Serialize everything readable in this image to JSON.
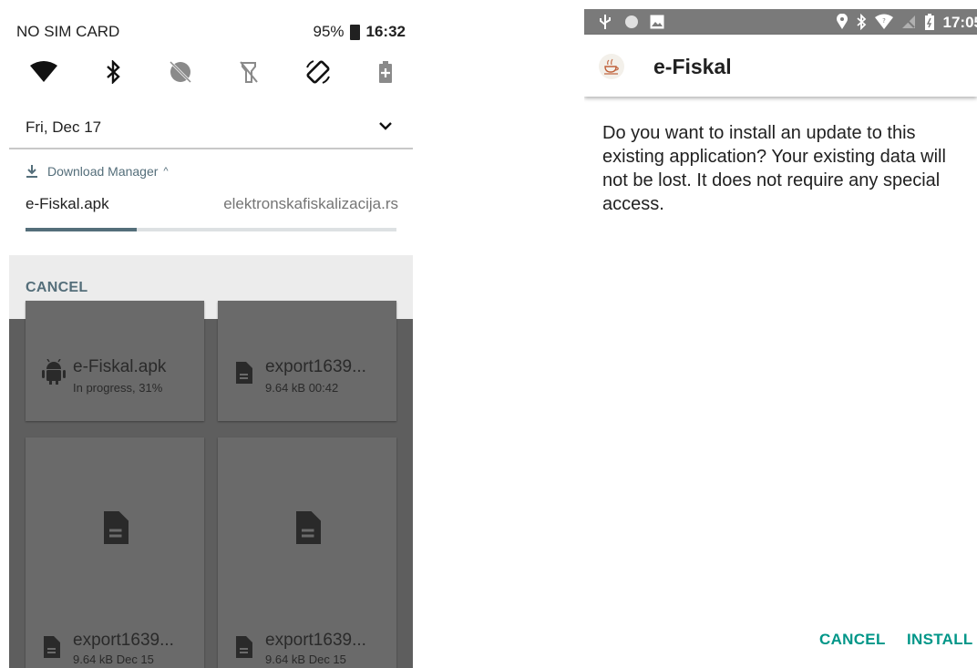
{
  "left": {
    "status_bar": {
      "carrier": "NO SIM CARD",
      "battery": "95%",
      "time": "16:32"
    },
    "quick_settings": [
      "wifi-icon",
      "bluetooth-icon",
      "dnd-icon",
      "flashlight-off-icon",
      "auto-rotate-icon",
      "battery-saver-icon"
    ],
    "date": "Fri, Dec 17",
    "download": {
      "app": "Download Manager",
      "filename": "e-Fiskal.apk",
      "site": "elektronskafiskalizacija.rs",
      "progress": 0.3
    },
    "cancel_label": "CANCEL",
    "files": [
      {
        "name": "e-Fiskal.apk",
        "sub": "In progress, 31%",
        "icon": "android-icon"
      },
      {
        "name": "export1639...",
        "sub": "9.64 kB 00:42",
        "icon": "document-icon"
      },
      {
        "name": "export1639...",
        "sub": "9.64 kB Dec 15",
        "icon": "document-icon"
      },
      {
        "name": "export1639...",
        "sub": "9.64 kB Dec 15",
        "icon": "document-icon"
      }
    ]
  },
  "right": {
    "status_bar": {
      "time": "17:05"
    },
    "app_title": "e-Fiskal",
    "message": "Do you want to install an update to this existing application? Your existing data will not be lost. It does not require any special access.",
    "cancel_label": "CANCEL",
    "install_label": "INSTALL",
    "accent": "#009688"
  }
}
